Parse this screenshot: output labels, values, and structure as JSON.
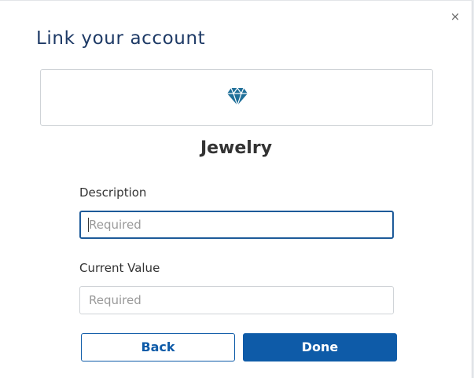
{
  "dialog": {
    "title": "Link your account",
    "close_icon": "close-icon",
    "close_glyph": "×"
  },
  "account": {
    "category_icon": "diamond-icon",
    "category_name": "Jewelry"
  },
  "form": {
    "description": {
      "label": "Description",
      "value": "",
      "placeholder": "Required",
      "focused": true
    },
    "current_value": {
      "label": "Current Value",
      "value": "",
      "placeholder": "Required"
    }
  },
  "actions": {
    "back_label": "Back",
    "done_label": "Done"
  },
  "colors": {
    "brand": "#0e5ba8",
    "title": "#1e3a66",
    "focus_border": "#1d5a99",
    "diamond": "#1f6f99"
  }
}
